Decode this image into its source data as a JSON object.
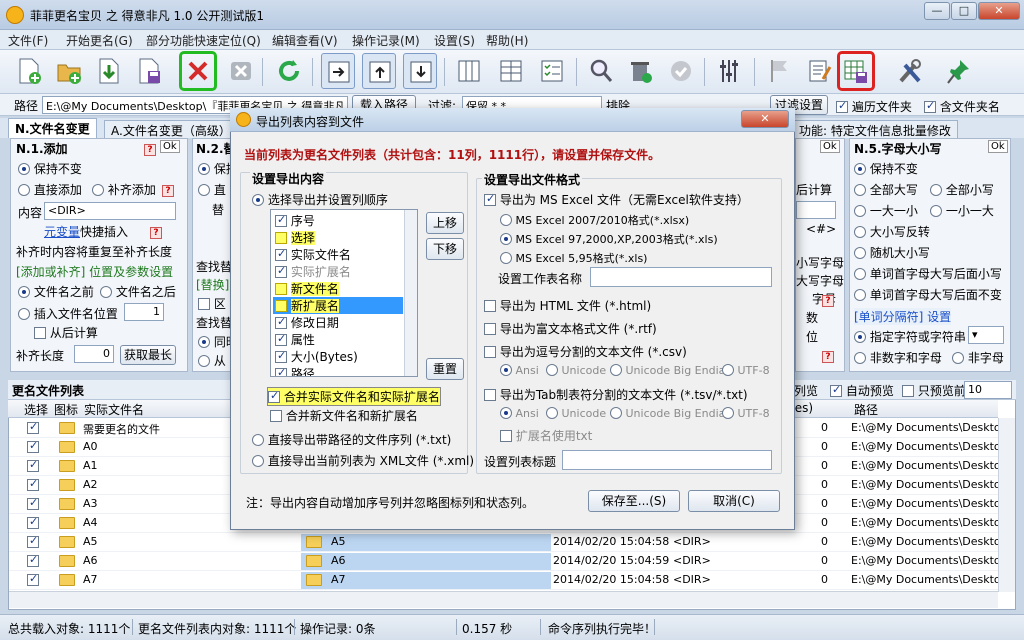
{
  "window": {
    "title": "菲菲更名宝贝 之 得意非凡 1.0 公开测试版1"
  },
  "menu": [
    "文件(F)",
    "开始更名(G)",
    "部分功能快速定位(Q)",
    "编辑查看(V)",
    "操作记录(M)",
    "设置(S)",
    "帮助(H)"
  ],
  "pathbar": {
    "path_label": "路径",
    "path_value": "E:\\@My Documents\\Desktop\\『菲菲更名宝贝 之 得意非凡",
    "load_btn": "载入路径",
    "filter_label": "过滤:",
    "filter_value": "保留 *.*",
    "exclude_label": "排除",
    "filter_settings_btn": "过滤设置",
    "traverse_folders": "遍历文件夹",
    "include_folder_name": "含文件夹名"
  },
  "tabs": {
    "t1": "N.文件名变更",
    "t2": "A.文件名变更（高级）",
    "t3": "功能: 特定文件信息批量修改"
  },
  "left_panel": {
    "title": "N.1.添加",
    "keep": "保持不变",
    "direct_add": "直接添加",
    "pad_add": "补齐添加",
    "content_label": "内容",
    "content_value": "<DIR>",
    "meta_link": "元变量",
    "quick_insert": "快捷插入",
    "note": "补齐时内容将重复至补齐长度",
    "section": "[添加或补齐] 位置及参数设置",
    "before_name": "文件名之前",
    "after_name": "文件名之后",
    "insert_pos": "插入文件名位置",
    "insert_val": "1",
    "count_back": "从后计算",
    "pad_len": "补齐长度",
    "pad_val": "0",
    "get_max": "获取最长"
  },
  "mid_panel": {
    "title": "N.2.替",
    "keep": "保持",
    "direct": "直",
    "replace": "替",
    "find_replace": "查找替",
    "replace_sec": "[替换]",
    "region": "区",
    "find_replace2": "查找替",
    "same": "同时",
    "from": "从"
  },
  "right_panel": {
    "title": "N.5.字母大小写",
    "keep": "保持不变",
    "all_upper": "全部大写",
    "all_lower": "全部小写",
    "first_upper": "一大一小",
    "first_lower": "一小一大",
    "invert": "大小写反转",
    "random": "随机大小写",
    "word_cap_lower": "单词首字母大写后面小写",
    "word_cap_keep": "单词首字母大写后面不变",
    "section": "[单词分隔符] 设置",
    "specified": "指定字符或字符串",
    "non_digit": "非数字和字母",
    "non_letter": "非字母"
  },
  "peek_right": {
    "calc_back": "后计算",
    "dir_tag": "<#>",
    "r1": "小写字母",
    "r2": "大写字母",
    "r3": "字母",
    "r4": "数",
    "r5": "位"
  },
  "file_list": {
    "title": "更名文件列表",
    "preview_list": "列览",
    "auto_preview": "自动预览",
    "preview_only": "只预览前",
    "preview_count": "10",
    "headers": {
      "select": "选择",
      "icon": "图标",
      "name": "实际文件名",
      "size": "tes)",
      "path": "路径"
    },
    "rows": [
      {
        "name": "需要更名的文件",
        "new": "",
        "date": "",
        "size": "",
        "path": "E:\\@My Documents\\Desktop"
      },
      {
        "name": "A0",
        "new": "",
        "date": "",
        "size": "",
        "path": "E:\\@My Documents\\Desktop"
      },
      {
        "name": "A1",
        "new": "",
        "date": "",
        "size": "",
        "path": "E:\\@My Documents\\Desktop"
      },
      {
        "name": "A2",
        "new": "",
        "date": "",
        "size": "",
        "path": "E:\\@My Documents\\Desktop"
      },
      {
        "name": "A3",
        "new": "",
        "date": "",
        "size": "",
        "path": "E:\\@My Documents\\Desktop"
      },
      {
        "name": "A4",
        "new": "",
        "date": "",
        "size": "",
        "path": "E:\\@My Documents\\Desktop"
      },
      {
        "name": "A5",
        "new": "A5",
        "date": "2014/02/20 15:04:58",
        "size": "<DIR>",
        "path": "E:\\@My Documents\\Desktop"
      },
      {
        "name": "A6",
        "new": "A6",
        "date": "2014/02/20 15:04:59",
        "size": "<DIR>",
        "path": "E:\\@My Documents\\Desktop"
      },
      {
        "name": "A7",
        "new": "A7",
        "date": "2014/02/20 15:04:58",
        "size": "<DIR>",
        "path": "E:\\@My Documents\\Desktop"
      }
    ],
    "row_size_suffix": "0"
  },
  "status": {
    "total": "总共载入对象: 1111个",
    "rename_list": "更名文件列表内对象: 1111个",
    "records": "操作记录: 0条",
    "time": "0.157 秒",
    "message": "命令序列执行完毕！"
  },
  "dialog": {
    "title": "导出列表内容到文件",
    "info": "当前列表为更名文件列表（共计包含：11列，1111行），请设置并保存文件。",
    "content_group": "设置导出内容",
    "select_cols": "选择导出并设置列顺序",
    "columns": [
      {
        "label": "序号",
        "checked": true,
        "grey": false,
        "hl": false,
        "sel": false
      },
      {
        "label": "选择",
        "checked": false,
        "grey": false,
        "hl": true,
        "sel": false
      },
      {
        "label": "实际文件名",
        "checked": true,
        "grey": false,
        "hl": false,
        "sel": false
      },
      {
        "label": "实际扩展名",
        "checked": true,
        "grey": true,
        "hl": false,
        "sel": false
      },
      {
        "label": "新文件名",
        "checked": false,
        "grey": false,
        "hl": true,
        "sel": false
      },
      {
        "label": "新扩展名",
        "checked": false,
        "grey": false,
        "hl": true,
        "sel": true
      },
      {
        "label": "修改日期",
        "checked": true,
        "grey": false,
        "hl": false,
        "sel": false
      },
      {
        "label": "属性",
        "checked": true,
        "grey": false,
        "hl": false,
        "sel": false
      },
      {
        "label": "大小(Bytes)",
        "checked": true,
        "grey": false,
        "hl": false,
        "sel": false
      },
      {
        "label": "路径",
        "checked": true,
        "grey": false,
        "hl": false,
        "sel": false
      }
    ],
    "move_up": "上移",
    "move_down": "下移",
    "reset": "重置",
    "merge_actual": "合并实际文件名和实际扩展名",
    "merge_new": "合并新文件名和新扩展名",
    "export_path_seq": "直接导出带路径的文件序列 (*.txt)",
    "export_xml": "直接导出当前列表为 XML文件 (*.xml)",
    "format_group": "设置导出文件格式",
    "excel": "导出为 MS Excel 文件（无需Excel软件支持）",
    "excel_2007": "MS Excel 2007/2010格式(*.xlsx)",
    "excel_97": "MS Excel 97,2000,XP,2003格式(*.xls)",
    "excel_95": "MS Excel 5,95格式(*.xls)",
    "sheet_name": "设置工作表名称",
    "html": "导出为 HTML 文件 (*.html)",
    "rtf": "导出为富文本格式文件 (*.rtf)",
    "csv": "导出为逗号分割的文本文件 (*.csv)",
    "ansi": "Ansi",
    "unicode": "Unicode",
    "unicode_be": "Unicode Big Endian",
    "utf8": "UTF-8",
    "tsv": "导出为Tab制表符分割的文本文件 (*.tsv/*.txt)",
    "ext_txt": "扩展名使用txt",
    "list_title": "设置列表标题",
    "note": "注：导出内容自动增加序号列并忽略图标列和状态列。",
    "save_btn": "保存至...(S)",
    "cancel_btn": "取消(C)"
  }
}
